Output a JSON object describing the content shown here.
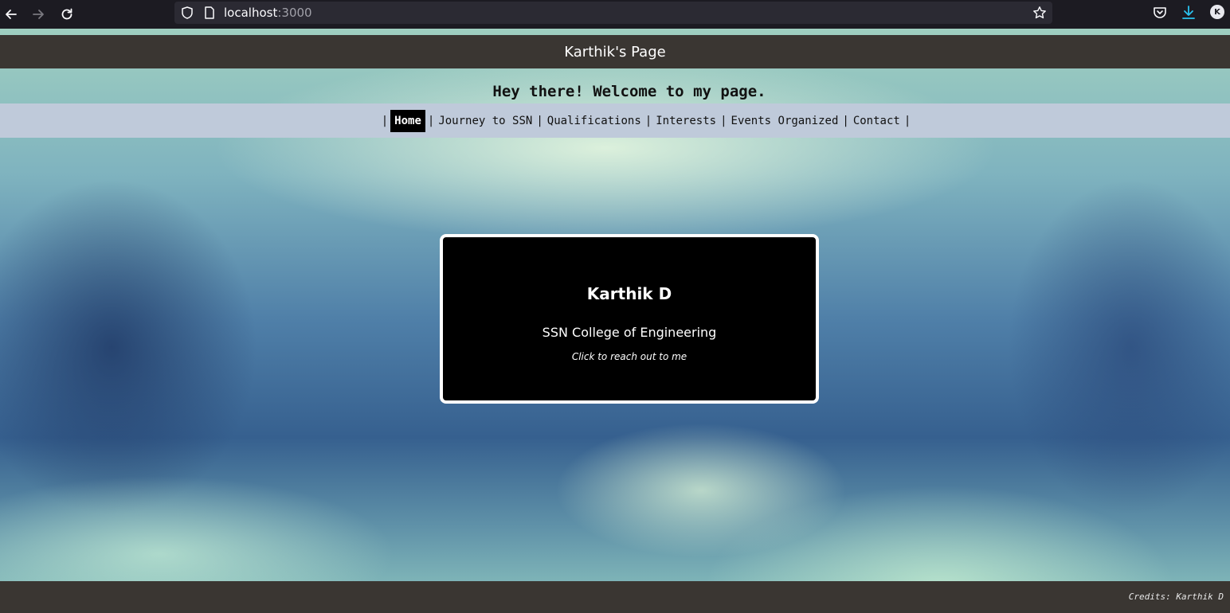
{
  "browser": {
    "url_host": "localhost",
    "url_port": ":3000",
    "profile_initial": "K"
  },
  "header": {
    "title": "Karthik's Page"
  },
  "welcome": {
    "text": "Hey there! Welcome to my page."
  },
  "nav": {
    "separator": "|",
    "items": [
      {
        "label": "Home",
        "active": true
      },
      {
        "label": "Journey to SSN",
        "active": false
      },
      {
        "label": "Qualifications",
        "active": false
      },
      {
        "label": "Interests",
        "active": false
      },
      {
        "label": "Events Organized",
        "active": false
      },
      {
        "label": "Contact",
        "active": false
      }
    ]
  },
  "card": {
    "name": "Karthik D",
    "college": "SSN College of Engineering",
    "cta": "Click to reach out to me"
  },
  "footer": {
    "credits": "Credits: Karthik D"
  },
  "icons": {
    "back": "back-arrow-icon",
    "forward": "forward-arrow-icon",
    "reload": "reload-icon",
    "shield": "shield-icon",
    "page": "page-icon",
    "bookmark": "star-icon",
    "pocket": "pocket-icon",
    "download": "download-icon"
  },
  "colors": {
    "header_bg": "#3a3632",
    "nav_bg": "#bfcada",
    "card_bg": "#000000",
    "download_accent": "#2ac3f0"
  }
}
